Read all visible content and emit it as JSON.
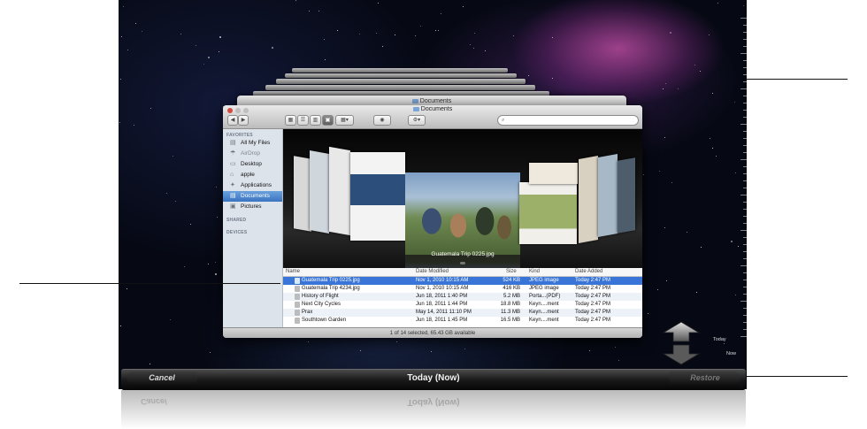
{
  "finder": {
    "back_title": "Documents",
    "title": "Documents",
    "search_placeholder": "",
    "toolbar": {
      "back": "◀",
      "forward": "▶",
      "view_icons": "▦",
      "view_list": "☰",
      "view_columns": "▥",
      "view_coverflow": "▣",
      "arrange": "▦▾",
      "quicklook": "◉",
      "action": "⚙▾"
    },
    "sidebar": {
      "favorites_header": "FAVORITES",
      "items": [
        {
          "label": "All My Files",
          "icon": "all-files-icon",
          "glyph": "▤"
        },
        {
          "label": "AirDrop",
          "icon": "airdrop-icon",
          "glyph": "☂"
        },
        {
          "label": "Desktop",
          "icon": "desktop-icon",
          "glyph": "▭"
        },
        {
          "label": "apple",
          "icon": "home-icon",
          "glyph": "⌂"
        },
        {
          "label": "Applications",
          "icon": "applications-icon",
          "glyph": "✦"
        },
        {
          "label": "Documents",
          "icon": "documents-icon",
          "glyph": "▤"
        },
        {
          "label": "Pictures",
          "icon": "pictures-icon",
          "glyph": "▣"
        }
      ],
      "shared_header": "SHARED",
      "devices_header": "DEVICES"
    },
    "coverflow_caption": "Guatemala Trip 0225.jpg",
    "list": {
      "columns": [
        "Name",
        "Date Modified",
        "Size",
        "Kind",
        "Date Added"
      ],
      "rows": [
        {
          "name": "Guatemala Trip 0225.jpg",
          "modified": "Nov 1, 2010 10:15 AM",
          "size": "524 KB",
          "kind": "JPEG image",
          "added": "Today 2:47 PM"
        },
        {
          "name": "Guatemala Trip 4234.jpg",
          "modified": "Nov 1, 2010 10:15 AM",
          "size": "416 KB",
          "kind": "JPEG image",
          "added": "Today 2:47 PM"
        },
        {
          "name": "History of Flight",
          "modified": "Jun 18, 2011 1:40 PM",
          "size": "5.2 MB",
          "kind": "Porta...(PDF)",
          "added": "Today 2:47 PM"
        },
        {
          "name": "Next City Cycles",
          "modified": "Jun 18, 2011 1:44 PM",
          "size": "18.8 MB",
          "kind": "Keyn....ment",
          "added": "Today 2:47 PM"
        },
        {
          "name": "Prax",
          "modified": "May 14, 2011 11:10 PM",
          "size": "11.3 MB",
          "kind": "Keyn....ment",
          "added": "Today 2:47 PM"
        },
        {
          "name": "Southtown Garden",
          "modified": "Jun 18, 2011 1:45 PM",
          "size": "16.5 MB",
          "kind": "Keyn....ment",
          "added": "Today 2:47 PM"
        }
      ]
    },
    "status": "1 of 14 selected, 65.43 GB available"
  },
  "timeline": {
    "today_label": "Today",
    "now_label": "Now"
  },
  "bottom_bar": {
    "cancel": "Cancel",
    "title": "Today (Now)",
    "restore": "Restore"
  },
  "colors": {
    "selection": "#3875d7",
    "sidebar_selection": "#3a74c0",
    "bar": "#1a1a1a"
  }
}
